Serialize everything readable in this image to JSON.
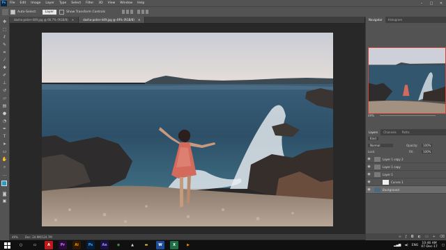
{
  "menu": {
    "items": [
      "File",
      "Edit",
      "Image",
      "Layer",
      "Type",
      "Select",
      "Filter",
      "3D",
      "View",
      "Window",
      "Help"
    ],
    "app_logo": "Ps",
    "window_controls": [
      "minimize-icon",
      "maximize-icon",
      "close-icon"
    ]
  },
  "options": {
    "auto_select_label": "Auto-Select:",
    "auto_select_value": "Layer",
    "transform_label": "Show Transform Controls"
  },
  "tabs": [
    {
      "label": "dasha-potier-449.jpg @ 66.7% (RGB/8)",
      "active": false
    },
    {
      "label": "dasha-potier-449.jpg @ 49% (RGB/8)",
      "active": true
    }
  ],
  "status": {
    "zoom": "49%",
    "doc": "Doc: 24.9M/124.7M"
  },
  "panels": {
    "top_tabs": [
      "Navigator",
      "Histogram"
    ],
    "nav_zoom": "49%",
    "mid_tabs": [
      "Layers",
      "Channels",
      "Paths"
    ],
    "kind_label": "Kind",
    "blend_mode": "Normal",
    "opacity_label": "Opacity:",
    "opacity_value": "100%",
    "lock_label": "Lock:",
    "fill_label": "Fill:",
    "fill_value": "100%",
    "layers": [
      {
        "name": "Layer 1 copy 2",
        "visible": true,
        "selected": false,
        "mask": false
      },
      {
        "name": "Layer 1 copy",
        "visible": true,
        "selected": false,
        "mask": false
      },
      {
        "name": "Layer 1",
        "visible": true,
        "selected": false,
        "mask": false
      },
      {
        "name": "Curves 1",
        "visible": true,
        "selected": false,
        "mask": true
      },
      {
        "name": "Background",
        "visible": true,
        "selected": true,
        "mask": false
      }
    ]
  },
  "taskbar": {
    "apps": [
      {
        "icon": "windows-start-icon",
        "label": "",
        "bg": "#101010",
        "fg": "#ffffff"
      },
      {
        "icon": "cortana-icon",
        "label": "○",
        "bg": "#101010",
        "fg": "#ffffff"
      },
      {
        "icon": "task-view-icon",
        "label": "▭",
        "bg": "#101010",
        "fg": "#ffffff"
      },
      {
        "icon": "acrobat-icon",
        "label": "A",
        "bg": "#c2181c",
        "fg": "#ffffff"
      },
      {
        "icon": "premiere-icon",
        "label": "Pr",
        "bg": "#2a0b3d",
        "fg": "#ea77ff"
      },
      {
        "icon": "illustrator-icon",
        "label": "Ai",
        "bg": "#2d1a00",
        "fg": "#ff9a00"
      },
      {
        "icon": "photoshop-icon",
        "label": "Ps",
        "bg": "#061e3c",
        "fg": "#31a8ff"
      },
      {
        "icon": "after-effects-icon",
        "label": "Ae",
        "bg": "#1d1045",
        "fg": "#9999ff"
      },
      {
        "icon": "chrome-icon",
        "label": "◉",
        "bg": "#101010",
        "fg": "#4caf50"
      },
      {
        "icon": "photos-icon",
        "label": "▲",
        "bg": "#101010",
        "fg": "#d8d8d8"
      },
      {
        "icon": "file-explorer-icon",
        "label": "▬",
        "bg": "#101010",
        "fg": "#f5c542"
      },
      {
        "icon": "word-icon",
        "label": "W",
        "bg": "#1d4e9a",
        "fg": "#ffffff"
      },
      {
        "icon": "excel-icon",
        "label": "X",
        "bg": "#1e7145",
        "fg": "#ffffff"
      },
      {
        "icon": "wmp-icon",
        "label": "▶",
        "bg": "#101010",
        "fg": "#ff8a00"
      }
    ],
    "lang": "ENG",
    "time": "10:46 AM",
    "date": "07-Dec-17"
  },
  "colors": {
    "accent": "#31a8ff",
    "foreground_swatch": "#1ea0c8",
    "background_swatch": "#ffffff"
  }
}
